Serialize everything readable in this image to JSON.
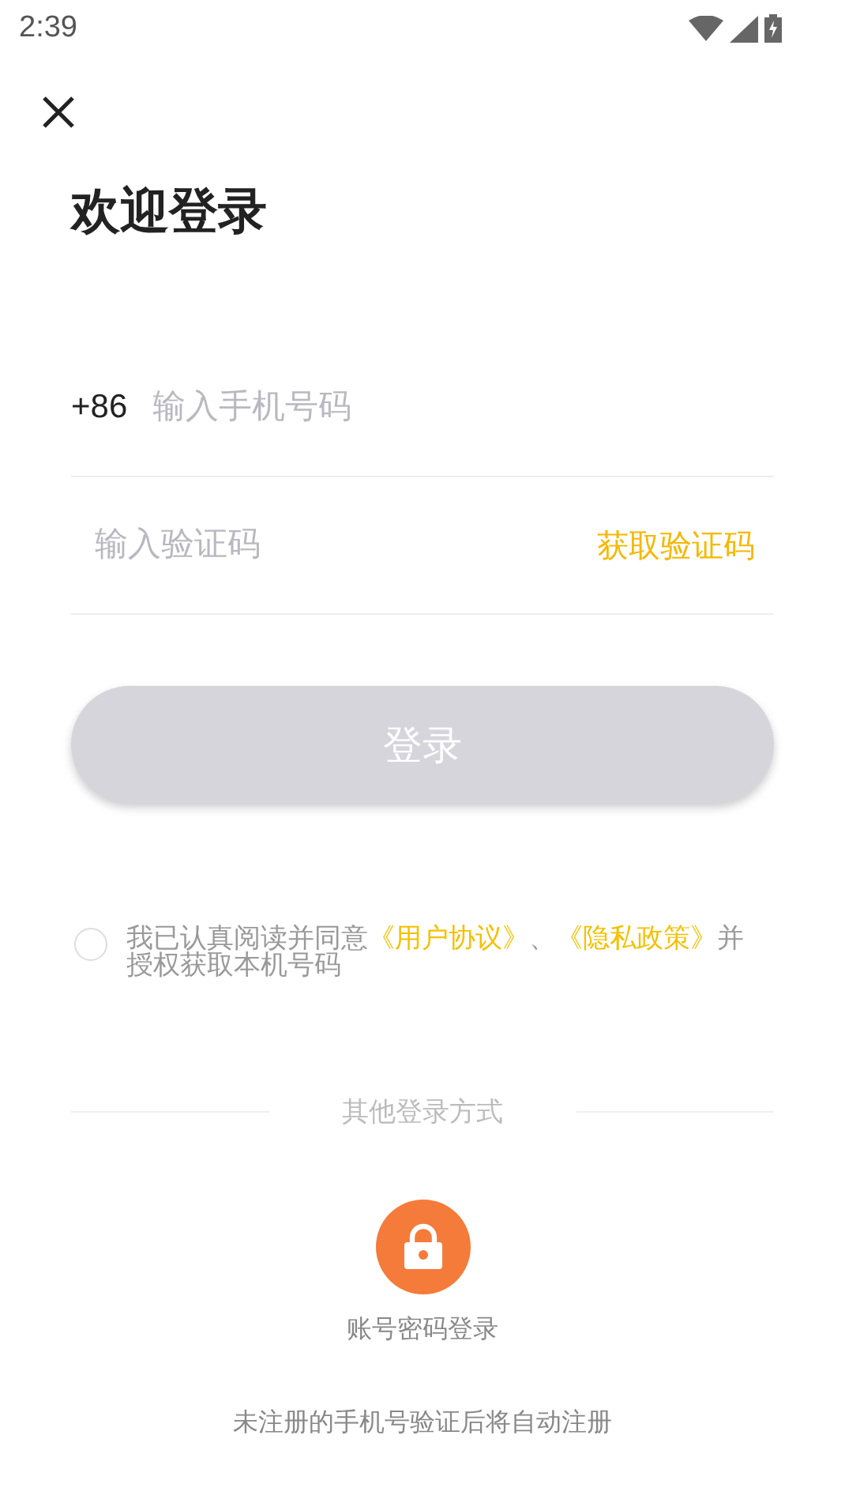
{
  "status_bar": {
    "time": "2:39"
  },
  "title": "欢迎登录",
  "phone_field": {
    "prefix": "+86",
    "placeholder": "输入手机号码"
  },
  "code_field": {
    "placeholder": "输入验证码",
    "action": "获取验证码"
  },
  "login_button": {
    "label": "登录",
    "disabled": true
  },
  "agreement": {
    "checked": false,
    "parts": [
      {
        "kind": "text",
        "text": "我已认真阅读并同意"
      },
      {
        "kind": "link",
        "text": "《用户协议》"
      },
      {
        "kind": "text",
        "text": "、"
      },
      {
        "kind": "link",
        "text": "《隐私政策》"
      },
      {
        "kind": "text",
        "text": "并授权获取本机号码"
      }
    ]
  },
  "other_methods": {
    "heading": "其他登录方式",
    "items": [
      {
        "label": "账号密码登录"
      }
    ]
  },
  "footer_note": "未注册的手机号验证后将自动注册"
}
